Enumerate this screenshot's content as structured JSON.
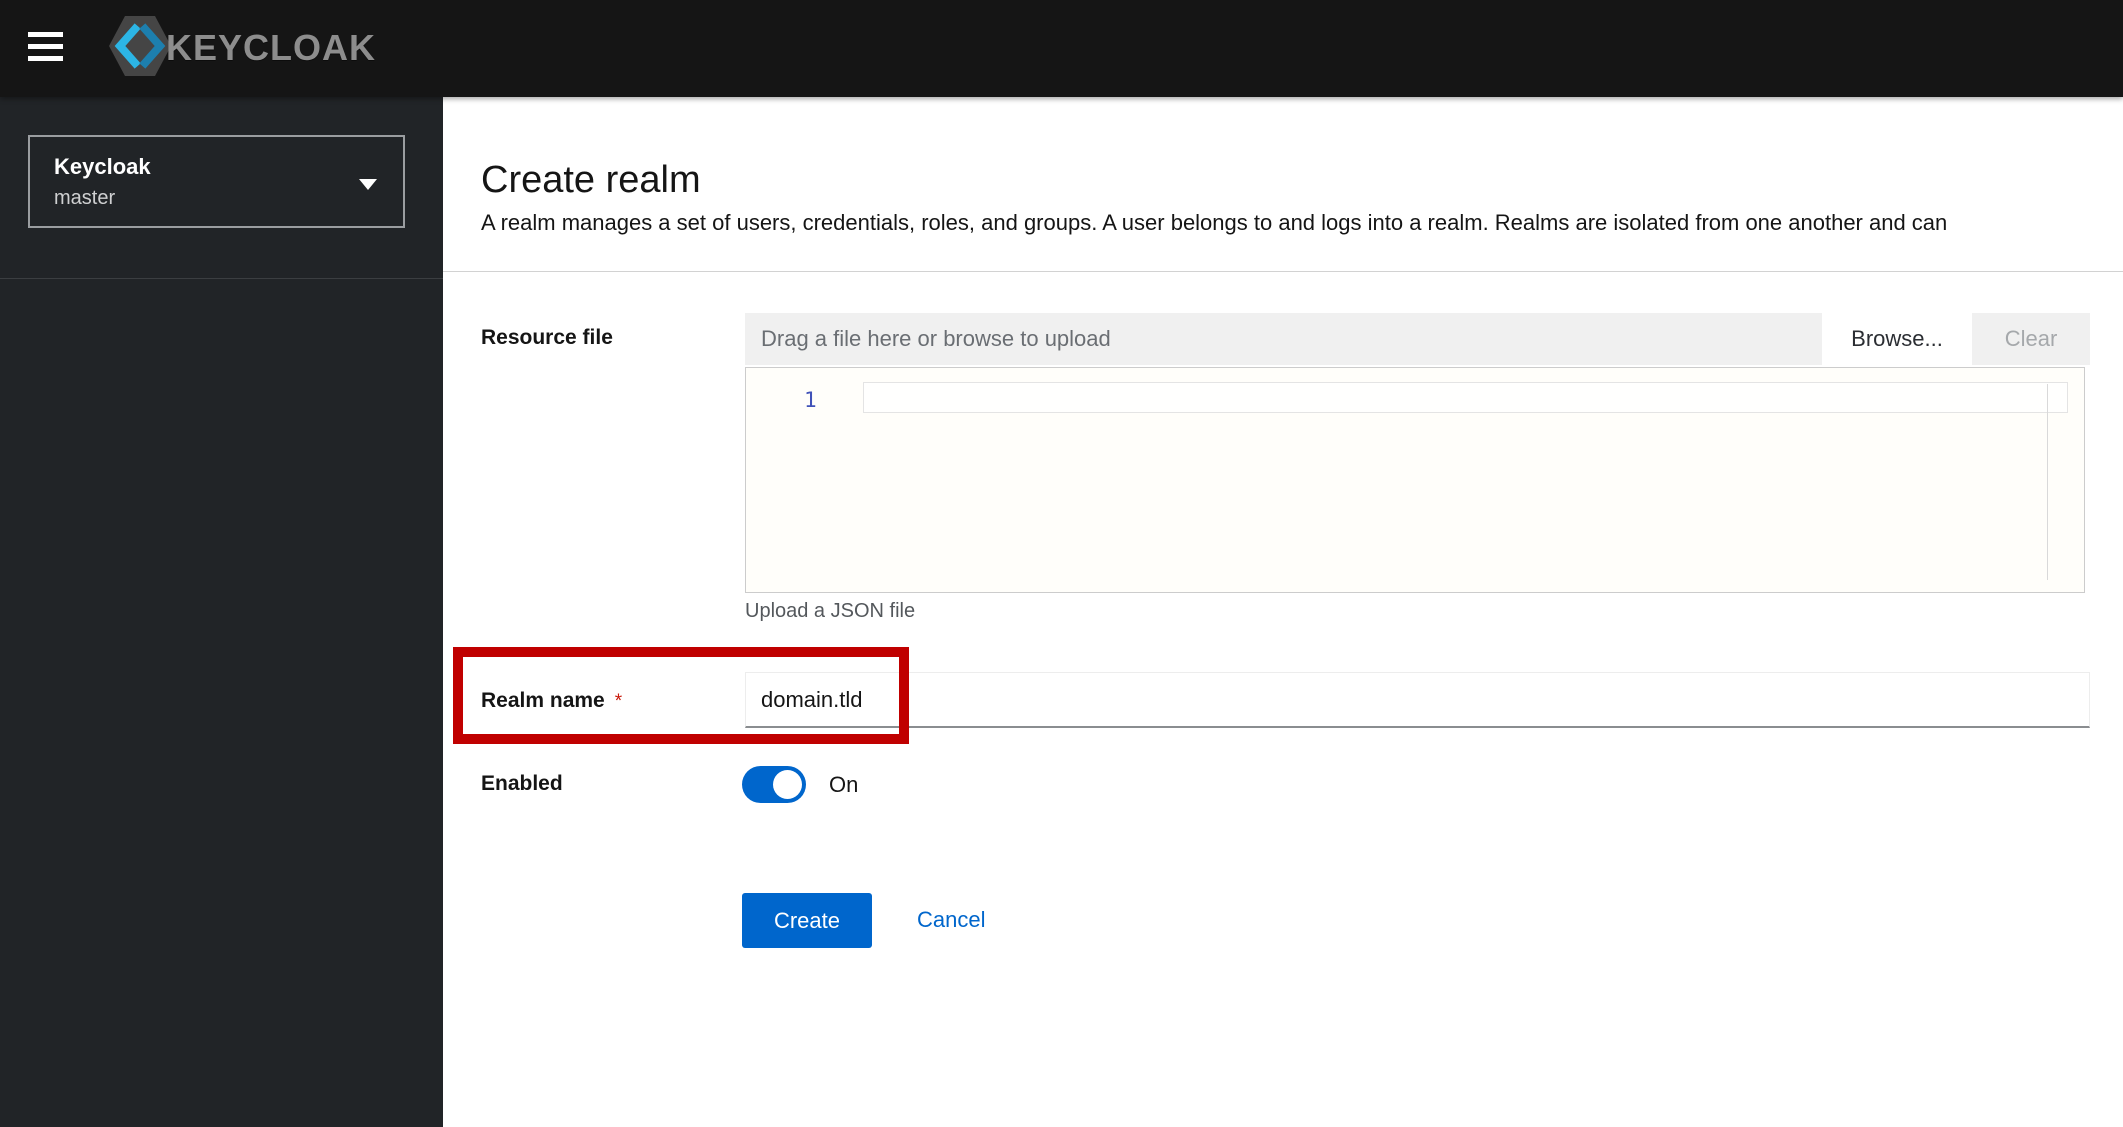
{
  "masthead": {
    "brand_text": "KEYCLOAK"
  },
  "sidebar": {
    "realm_switcher": {
      "title": "Keycloak",
      "current_realm": "master"
    }
  },
  "page": {
    "title": "Create realm",
    "description": "A realm manages a set of users, credentials, roles, and groups. A user belongs to and logs into a realm. Realms are isolated from one another and can"
  },
  "form": {
    "resource_file": {
      "label": "Resource file",
      "placeholder": "Drag a file here or browse to upload",
      "browse_label": "Browse...",
      "clear_label": "Clear",
      "editor_line_number": "1",
      "helper_text": "Upload a JSON file"
    },
    "realm_name": {
      "label": "Realm name",
      "required_indicator": "*",
      "value": "domain.tld"
    },
    "enabled": {
      "label": "Enabled",
      "state_label": "On"
    },
    "actions": {
      "create_label": "Create",
      "cancel_label": "Cancel"
    }
  },
  "annotation": {
    "highlight_color": "#c00000"
  },
  "colors": {
    "accent": "#0066cc",
    "masthead_bg": "#151515",
    "sidebar_bg": "#212427",
    "required_red": "#c9190b"
  }
}
